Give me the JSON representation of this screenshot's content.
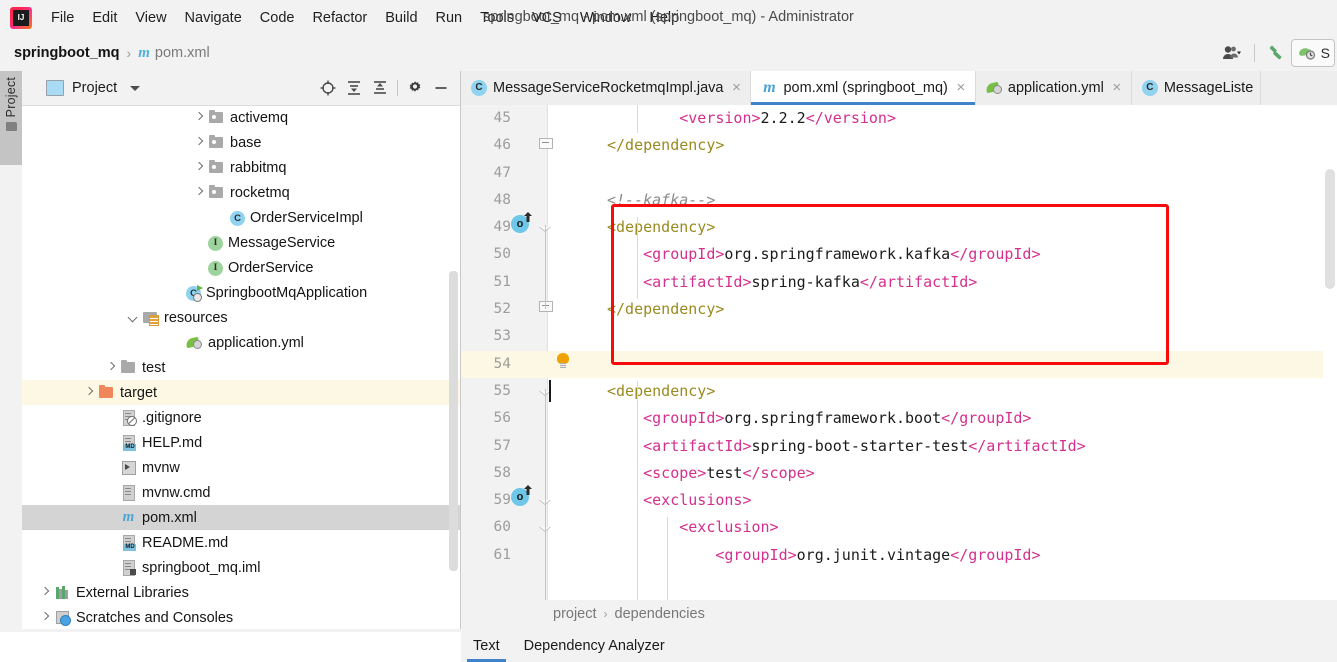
{
  "window": {
    "title": "springboot_mq - pom.xml (springboot_mq) - Administrator",
    "logo": "intellij-idea-logo"
  },
  "menubar": {
    "items": [
      {
        "label": "File"
      },
      {
        "label": "Edit"
      },
      {
        "label": "View"
      },
      {
        "label": "Navigate"
      },
      {
        "label": "Code"
      },
      {
        "label": "Refactor"
      },
      {
        "label": "Build"
      },
      {
        "label": "Run"
      },
      {
        "label": "Tools"
      },
      {
        "label": "VCS"
      },
      {
        "label": "Window"
      },
      {
        "label": "Help"
      }
    ]
  },
  "navbar": {
    "project": "springboot_mq",
    "separator": "›",
    "file": "pom.xml",
    "maven_glyph": "m",
    "icons": [
      {
        "name": "user-account-icon"
      },
      {
        "name": "build-hammer-icon"
      },
      {
        "name": "run-with-coverage-icon"
      }
    ],
    "run_config_label": "S"
  },
  "toolstripe": {
    "label": "Project",
    "icon": "folder-icon"
  },
  "project_panel": {
    "title": "Project",
    "header_icons": [
      {
        "name": "select-opened-file-icon"
      },
      {
        "name": "expand-all-icon"
      },
      {
        "name": "collapse-all-icon"
      },
      {
        "name": "settings-gear-icon"
      },
      {
        "name": "hide-panel-icon"
      }
    ],
    "tree": [
      {
        "label": "activemq",
        "icon": "folder-package-icon",
        "indent": 171,
        "arrow": "closed",
        "state": "normal"
      },
      {
        "label": "base",
        "icon": "folder-package-icon",
        "indent": 171,
        "arrow": "closed",
        "state": "normal"
      },
      {
        "label": "rabbitmq",
        "icon": "folder-package-icon",
        "indent": 171,
        "arrow": "closed",
        "state": "normal"
      },
      {
        "label": "rocketmq",
        "icon": "folder-package-icon",
        "indent": 171,
        "arrow": "closed",
        "state": "normal"
      },
      {
        "label": "OrderServiceImpl",
        "icon": "java-class-icon",
        "indent": 193,
        "arrow": "none",
        "state": "normal"
      },
      {
        "label": "MessageService",
        "icon": "java-interface-icon",
        "indent": 171,
        "arrow": "none",
        "state": "normal"
      },
      {
        "label": "OrderService",
        "icon": "java-interface-icon",
        "indent": 171,
        "arrow": "none",
        "state": "normal"
      },
      {
        "label": "SpringbootMqApplication",
        "icon": "spring-class-icon",
        "indent": 149,
        "arrow": "none",
        "state": "normal"
      },
      {
        "label": "resources",
        "icon": "resources-folder-icon",
        "indent": 105,
        "arrow": "open",
        "state": "normal"
      },
      {
        "label": "application.yml",
        "icon": "yaml-spring-icon",
        "indent": 149,
        "arrow": "none",
        "state": "normal"
      },
      {
        "label": "test",
        "icon": "folder-icon",
        "indent": 83,
        "arrow": "closed",
        "state": "normal"
      },
      {
        "label": "target",
        "icon": "folder-orange-icon",
        "indent": 61,
        "arrow": "closed",
        "state": "highlight"
      },
      {
        "label": ".gitignore",
        "icon": "gitignore-file-icon",
        "indent": 83,
        "arrow": "none",
        "state": "normal"
      },
      {
        "label": "HELP.md",
        "icon": "markdown-file-icon",
        "indent": 83,
        "arrow": "none",
        "state": "normal"
      },
      {
        "label": "mvnw",
        "icon": "shell-script-icon",
        "indent": 83,
        "arrow": "none",
        "state": "normal"
      },
      {
        "label": "mvnw.cmd",
        "icon": "text-file-icon",
        "indent": 83,
        "arrow": "none",
        "state": "normal"
      },
      {
        "label": "pom.xml",
        "icon": "maven-file-icon",
        "indent": 83,
        "arrow": "none",
        "state": "selected"
      },
      {
        "label": "README.md",
        "icon": "markdown-file-icon",
        "indent": 83,
        "arrow": "none",
        "state": "normal"
      },
      {
        "label": "springboot_mq.iml",
        "icon": "iml-file-icon",
        "indent": 83,
        "arrow": "none",
        "state": "normal"
      },
      {
        "label": "External Libraries",
        "icon": "libraries-icon",
        "indent": 17,
        "arrow": "closed",
        "state": "normal"
      },
      {
        "label": "Scratches and Consoles",
        "icon": "scratches-icon",
        "indent": 17,
        "arrow": "closed",
        "state": "normal"
      }
    ]
  },
  "editor": {
    "tabs": [
      {
        "label": "MessageServiceRocketmqImpl.java",
        "icon": "java-class-icon",
        "active": false,
        "close": "×"
      },
      {
        "label": "pom.xml (springboot_mq)",
        "icon": "maven-file-icon",
        "active": true,
        "close": "×"
      },
      {
        "label": "application.yml",
        "icon": "yaml-spring-icon",
        "active": false,
        "close": "×"
      },
      {
        "label": "MessageListe",
        "icon": "java-class-icon",
        "active": false,
        "close": ""
      }
    ],
    "code_lines": [
      {
        "num": "45",
        "indent": 8,
        "tokens": [
          {
            "t": "<version>",
            "c": "tg2"
          },
          {
            "t": "2.2.2",
            "c": "nm"
          },
          {
            "t": "</version>",
            "c": "tg2"
          }
        ]
      },
      {
        "num": "46",
        "indent": 0,
        "tokens": [
          {
            "t": "</dependency>",
            "c": "tg"
          }
        ]
      },
      {
        "num": "47",
        "indent": 0,
        "tokens": []
      },
      {
        "num": "48",
        "indent": 0,
        "tokens": [
          {
            "t": "<!--kafka-->",
            "c": "cm"
          }
        ]
      },
      {
        "num": "49",
        "indent": 0,
        "tokens": [
          {
            "t": "<dependency>",
            "c": "tg"
          }
        ]
      },
      {
        "num": "50",
        "indent": 4,
        "tokens": [
          {
            "t": "<groupId>",
            "c": "tg2"
          },
          {
            "t": "org.springframework.kafka",
            "c": "nm"
          },
          {
            "t": "</groupId>",
            "c": "tg2"
          }
        ]
      },
      {
        "num": "51",
        "indent": 4,
        "tokens": [
          {
            "t": "<artifactId>",
            "c": "tg2"
          },
          {
            "t": "spring-kafka",
            "c": "nm"
          },
          {
            "t": "</artifactId>",
            "c": "tg2"
          }
        ]
      },
      {
        "num": "52",
        "indent": 0,
        "tokens": [
          {
            "t": "</dependency>",
            "c": "tg"
          }
        ]
      },
      {
        "num": "53",
        "indent": 0,
        "tokens": []
      },
      {
        "num": "54",
        "indent": 0,
        "tokens": [],
        "current": true
      },
      {
        "num": "55",
        "indent": 0,
        "tokens": [
          {
            "t": "<dependency>",
            "c": "tg"
          }
        ]
      },
      {
        "num": "56",
        "indent": 4,
        "tokens": [
          {
            "t": "<groupId>",
            "c": "tg2"
          },
          {
            "t": "org.springframework.boot",
            "c": "nm"
          },
          {
            "t": "</groupId>",
            "c": "tg2"
          }
        ]
      },
      {
        "num": "57",
        "indent": 4,
        "tokens": [
          {
            "t": "<artifactId>",
            "c": "tg2"
          },
          {
            "t": "spring-boot-starter-test",
            "c": "nm"
          },
          {
            "t": "</artifactId>",
            "c": "tg2"
          }
        ]
      },
      {
        "num": "58",
        "indent": 4,
        "tokens": [
          {
            "t": "<scope>",
            "c": "tg2"
          },
          {
            "t": "test",
            "c": "nm"
          },
          {
            "t": "</scope>",
            "c": "tg2"
          }
        ]
      },
      {
        "num": "59",
        "indent": 4,
        "tokens": [
          {
            "t": "<exclusions>",
            "c": "tg2"
          }
        ]
      },
      {
        "num": "60",
        "indent": 8,
        "tokens": [
          {
            "t": "<exclusion>",
            "c": "tg2"
          }
        ]
      },
      {
        "num": "61",
        "indent": 12,
        "tokens": [
          {
            "t": "<groupId>",
            "c": "tg2"
          },
          {
            "t": "org.junit.vintage",
            "c": "nm"
          },
          {
            "t": "</groupId>",
            "c": "tg2"
          }
        ]
      }
    ],
    "gutter_icons": [
      {
        "name": "maven-dependency-icon",
        "line": "49",
        "glyph": "o"
      },
      {
        "name": "maven-dependency-icon",
        "line": "55",
        "glyph": "o"
      },
      {
        "name": "intention-bulb-icon",
        "line": "53",
        "glyph": ""
      }
    ],
    "annotation": {
      "name": "red-highlight-box",
      "color": "#f60c0c"
    }
  },
  "breadcrumb_bar": {
    "items": [
      "project",
      "dependencies"
    ],
    "separator": "›"
  },
  "bottom_tabs": [
    {
      "label": "Text",
      "active": true
    },
    {
      "label": "Dependency Analyzer",
      "active": false
    }
  ]
}
